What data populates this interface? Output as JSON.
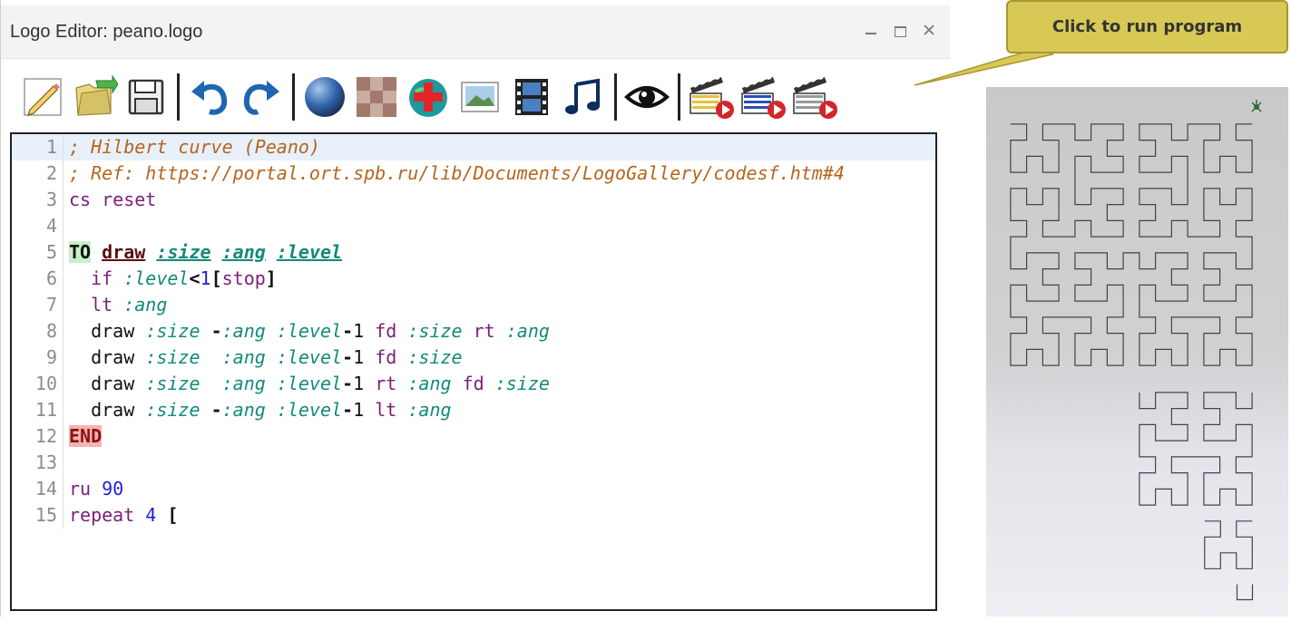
{
  "window": {
    "title": "Logo Editor: peano.logo"
  },
  "window_controls": {
    "minimize": "minimize-icon",
    "maximize": "maximize-icon",
    "close": "close-icon"
  },
  "toolbar": {
    "buttons": [
      {
        "name": "new-file",
        "icon": "pencil-page-icon"
      },
      {
        "name": "open-file",
        "icon": "folder-arrow-icon"
      },
      {
        "name": "save-file",
        "icon": "floppy-disk-icon"
      },
      {
        "name": "undo",
        "icon": "undo-arrow-icon"
      },
      {
        "name": "redo",
        "icon": "redo-arrow-icon"
      },
      {
        "name": "sphere",
        "icon": "sphere-icon"
      },
      {
        "name": "texture",
        "icon": "checker-texture-icon"
      },
      {
        "name": "add-object",
        "icon": "globe-plus-icon"
      },
      {
        "name": "image",
        "icon": "picture-icon"
      },
      {
        "name": "video",
        "icon": "film-strip-icon"
      },
      {
        "name": "music",
        "icon": "music-note-icon"
      },
      {
        "name": "view",
        "icon": "eye-icon"
      },
      {
        "name": "run-program",
        "icon": "clapper-play-icon"
      },
      {
        "name": "run-list",
        "icon": "clapper-list-play-icon"
      },
      {
        "name": "run-step",
        "icon": "clapper-red-play-icon"
      }
    ]
  },
  "callout": {
    "text": "Click to run program"
  },
  "code": {
    "lines": [
      {
        "num": "1",
        "parts": [
          {
            "t": "; Hilbert curve (Peano)",
            "c": "t-comment"
          }
        ]
      },
      {
        "num": "2",
        "parts": [
          {
            "t": "; Ref: https://portal.ort.spb.ru/lib/Documents/LogoGallery/codesf.htm#4",
            "c": "t-comment"
          }
        ]
      },
      {
        "num": "3",
        "parts": [
          {
            "t": "cs reset",
            "c": "t-cmd"
          }
        ]
      },
      {
        "num": "4",
        "parts": []
      },
      {
        "num": "5",
        "parts": [
          {
            "t": "TO",
            "c": "t-to"
          },
          {
            "t": " ",
            "c": "t-plain"
          },
          {
            "t": "draw",
            "c": "t-procname"
          },
          {
            "t": " ",
            "c": "t-plain"
          },
          {
            "t": ":size",
            "c": "t-param"
          },
          {
            "t": " ",
            "c": "t-plain"
          },
          {
            "t": ":ang",
            "c": "t-param"
          },
          {
            "t": " ",
            "c": "t-plain"
          },
          {
            "t": ":level",
            "c": "t-param"
          }
        ]
      },
      {
        "num": "6",
        "parts": [
          {
            "t": "  if ",
            "c": "t-cmd"
          },
          {
            "t": ":level",
            "c": "t-var"
          },
          {
            "t": "<",
            "c": "t-op"
          },
          {
            "t": "1",
            "c": "t-num"
          },
          {
            "t": "[",
            "c": "t-op"
          },
          {
            "t": "stop",
            "c": "t-cmd"
          },
          {
            "t": "]",
            "c": "t-op"
          }
        ]
      },
      {
        "num": "7",
        "parts": [
          {
            "t": "  lt ",
            "c": "t-cmd"
          },
          {
            "t": ":ang",
            "c": "t-var"
          }
        ]
      },
      {
        "num": "8",
        "parts": [
          {
            "t": "  draw ",
            "c": "t-plain"
          },
          {
            "t": ":size",
            "c": "t-var"
          },
          {
            "t": " -",
            "c": "t-op"
          },
          {
            "t": ":ang",
            "c": "t-var"
          },
          {
            "t": " ",
            "c": "t-plain"
          },
          {
            "t": ":level",
            "c": "t-var"
          },
          {
            "t": "-",
            "c": "t-op"
          },
          {
            "t": "1",
            "c": "t-plain"
          },
          {
            "t": " fd ",
            "c": "t-cmd"
          },
          {
            "t": ":size",
            "c": "t-var"
          },
          {
            "t": " rt ",
            "c": "t-cmd"
          },
          {
            "t": ":ang",
            "c": "t-var"
          }
        ]
      },
      {
        "num": "9",
        "parts": [
          {
            "t": "  draw ",
            "c": "t-plain"
          },
          {
            "t": ":size",
            "c": "t-var"
          },
          {
            "t": "  ",
            "c": "t-plain"
          },
          {
            "t": ":ang",
            "c": "t-var"
          },
          {
            "t": " ",
            "c": "t-plain"
          },
          {
            "t": ":level",
            "c": "t-var"
          },
          {
            "t": "-",
            "c": "t-op"
          },
          {
            "t": "1",
            "c": "t-plain"
          },
          {
            "t": " fd ",
            "c": "t-cmd"
          },
          {
            "t": ":size",
            "c": "t-var"
          }
        ]
      },
      {
        "num": "10",
        "parts": [
          {
            "t": "  draw ",
            "c": "t-plain"
          },
          {
            "t": ":size",
            "c": "t-var"
          },
          {
            "t": "  ",
            "c": "t-plain"
          },
          {
            "t": ":ang",
            "c": "t-var"
          },
          {
            "t": " ",
            "c": "t-plain"
          },
          {
            "t": ":level",
            "c": "t-var"
          },
          {
            "t": "-",
            "c": "t-op"
          },
          {
            "t": "1",
            "c": "t-plain"
          },
          {
            "t": " rt ",
            "c": "t-cmd"
          },
          {
            "t": ":ang",
            "c": "t-var"
          },
          {
            "t": " fd ",
            "c": "t-cmd"
          },
          {
            "t": ":size",
            "c": "t-var"
          }
        ]
      },
      {
        "num": "11",
        "parts": [
          {
            "t": "  draw ",
            "c": "t-plain"
          },
          {
            "t": ":size",
            "c": "t-var"
          },
          {
            "t": " -",
            "c": "t-op"
          },
          {
            "t": ":ang",
            "c": "t-var"
          },
          {
            "t": " ",
            "c": "t-plain"
          },
          {
            "t": ":level",
            "c": "t-var"
          },
          {
            "t": "-",
            "c": "t-op"
          },
          {
            "t": "1",
            "c": "t-plain"
          },
          {
            "t": " lt ",
            "c": "t-cmd"
          },
          {
            "t": ":ang",
            "c": "t-var"
          }
        ]
      },
      {
        "num": "12",
        "parts": [
          {
            "t": "END",
            "c": "t-end"
          }
        ]
      },
      {
        "num": "13",
        "parts": []
      },
      {
        "num": "14",
        "parts": [
          {
            "t": "ru ",
            "c": "t-cmd"
          },
          {
            "t": "90",
            "c": "t-num"
          }
        ]
      },
      {
        "num": "15",
        "parts": [
          {
            "t": "repeat ",
            "c": "t-cmd"
          },
          {
            "t": "4",
            "c": "t-num"
          },
          {
            "t": " [",
            "c": "t-op"
          }
        ]
      }
    ]
  },
  "canvas": {
    "turtle": "turtle-icon",
    "curve_stroke": "#444444"
  }
}
